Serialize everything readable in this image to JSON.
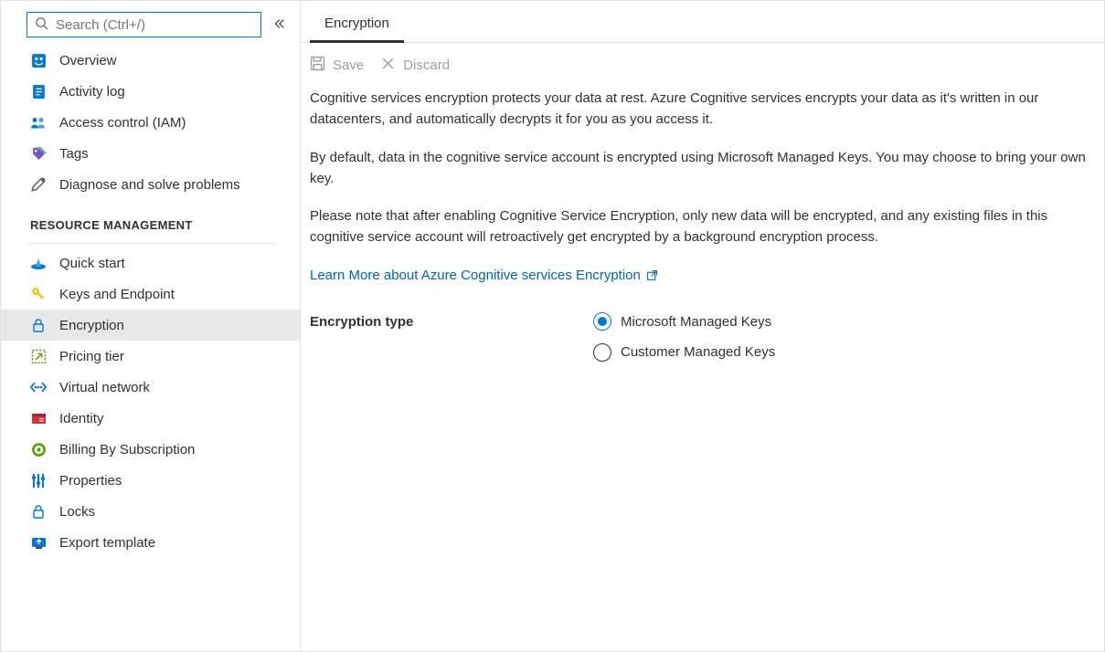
{
  "search": {
    "placeholder": "Search (Ctrl+/)"
  },
  "sidebar": {
    "items": [
      {
        "label": "Overview",
        "active": false,
        "icon": "overview"
      },
      {
        "label": "Activity log",
        "active": false,
        "icon": "activity"
      },
      {
        "label": "Access control (IAM)",
        "active": false,
        "icon": "iam"
      },
      {
        "label": "Tags",
        "active": false,
        "icon": "tags"
      },
      {
        "label": "Diagnose and solve problems",
        "active": false,
        "icon": "diagnose"
      }
    ],
    "section_header": "RESOURCE MANAGEMENT",
    "resource_items": [
      {
        "label": "Quick start",
        "active": false,
        "icon": "quickstart"
      },
      {
        "label": "Keys and Endpoint",
        "active": false,
        "icon": "key"
      },
      {
        "label": "Encryption",
        "active": true,
        "icon": "lock"
      },
      {
        "label": "Pricing tier",
        "active": false,
        "icon": "pricing"
      },
      {
        "label": "Virtual network",
        "active": false,
        "icon": "vnet"
      },
      {
        "label": "Identity",
        "active": false,
        "icon": "identity"
      },
      {
        "label": "Billing By Subscription",
        "active": false,
        "icon": "billing"
      },
      {
        "label": "Properties",
        "active": false,
        "icon": "properties"
      },
      {
        "label": "Locks",
        "active": false,
        "icon": "locks"
      },
      {
        "label": "Export template",
        "active": false,
        "icon": "export"
      }
    ]
  },
  "main": {
    "tabs": [
      {
        "label": "Encryption",
        "active": true
      }
    ],
    "toolbar": {
      "save": "Save",
      "discard": "Discard"
    },
    "paragraphs": [
      "Cognitive services encryption protects your data at rest. Azure Cognitive services encrypts your data as it's written in our datacenters, and automatically decrypts it for you as you access it.",
      "By default, data in the cognitive service account is encrypted using Microsoft Managed Keys. You may choose to bring your own key.",
      "Please note that after enabling Cognitive Service Encryption, only new data will be encrypted, and any existing files in this cognitive service account will retroactively get encrypted by a background encryption process."
    ],
    "link": "Learn More about Azure Cognitive services Encryption",
    "form": {
      "label": "Encryption type",
      "options": [
        {
          "label": "Microsoft Managed Keys",
          "checked": true
        },
        {
          "label": "Customer Managed Keys",
          "checked": false
        }
      ]
    }
  }
}
